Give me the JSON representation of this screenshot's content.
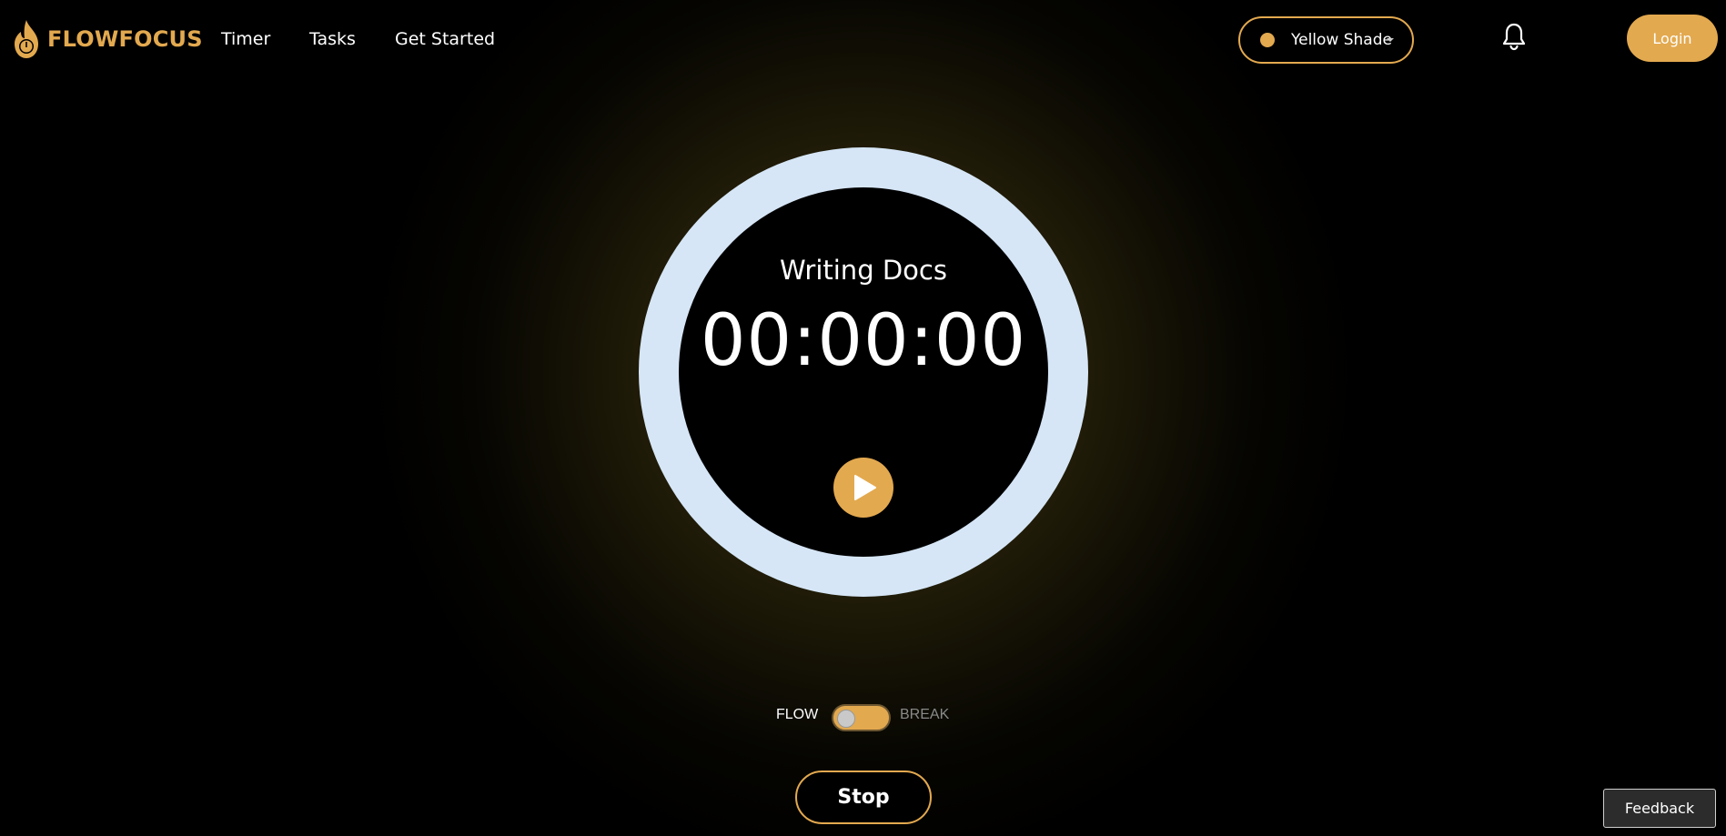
{
  "brand": {
    "name": "FLOWFOCUS",
    "logo_icon": "flame-timer-icon",
    "color": "#e3a94f"
  },
  "nav": {
    "links": [
      {
        "label": "Timer"
      },
      {
        "label": "Tasks"
      },
      {
        "label": "Get Started"
      }
    ]
  },
  "theme_select": {
    "selected": "Yellow Shade",
    "dot_color": "#e3a94f",
    "caret_icon": "caret-down-icon"
  },
  "notifications": {
    "icon": "bell-icon"
  },
  "auth": {
    "login_label": "Login"
  },
  "timer": {
    "task": "Writing Docs",
    "time": "00:00:00",
    "ring_color": "#d6e6f7",
    "play_icon": "play-icon"
  },
  "mode": {
    "left_label": "FLOW",
    "right_label": "BREAK",
    "active": "FLOW"
  },
  "controls": {
    "stop_label": "Stop"
  },
  "feedback": {
    "label": "Feedback"
  },
  "accent": "#e3a94f"
}
